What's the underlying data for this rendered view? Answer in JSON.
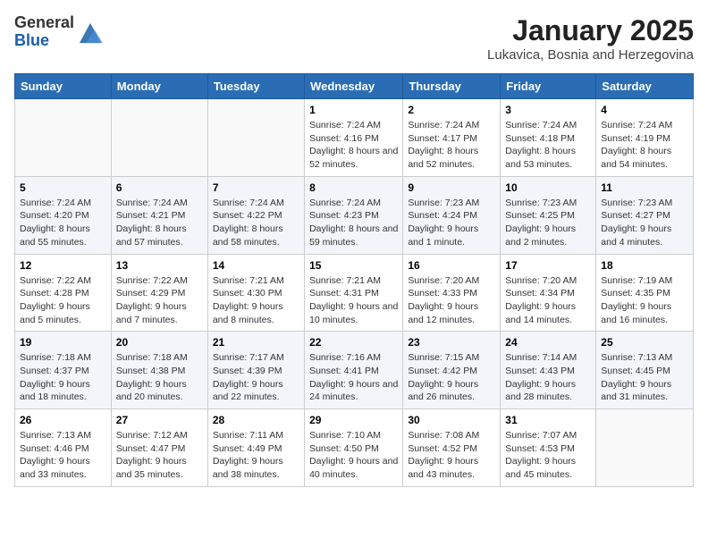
{
  "header": {
    "logo_line1": "General",
    "logo_line2": "Blue",
    "month_title": "January 2025",
    "location": "Lukavica, Bosnia and Herzegovina"
  },
  "weekdays": [
    "Sunday",
    "Monday",
    "Tuesday",
    "Wednesday",
    "Thursday",
    "Friday",
    "Saturday"
  ],
  "weeks": [
    [
      {
        "day": "",
        "info": ""
      },
      {
        "day": "",
        "info": ""
      },
      {
        "day": "",
        "info": ""
      },
      {
        "day": "1",
        "info": "Sunrise: 7:24 AM\nSunset: 4:16 PM\nDaylight: 8 hours and 52 minutes."
      },
      {
        "day": "2",
        "info": "Sunrise: 7:24 AM\nSunset: 4:17 PM\nDaylight: 8 hours and 52 minutes."
      },
      {
        "day": "3",
        "info": "Sunrise: 7:24 AM\nSunset: 4:18 PM\nDaylight: 8 hours and 53 minutes."
      },
      {
        "day": "4",
        "info": "Sunrise: 7:24 AM\nSunset: 4:19 PM\nDaylight: 8 hours and 54 minutes."
      }
    ],
    [
      {
        "day": "5",
        "info": "Sunrise: 7:24 AM\nSunset: 4:20 PM\nDaylight: 8 hours and 55 minutes."
      },
      {
        "day": "6",
        "info": "Sunrise: 7:24 AM\nSunset: 4:21 PM\nDaylight: 8 hours and 57 minutes."
      },
      {
        "day": "7",
        "info": "Sunrise: 7:24 AM\nSunset: 4:22 PM\nDaylight: 8 hours and 58 minutes."
      },
      {
        "day": "8",
        "info": "Sunrise: 7:24 AM\nSunset: 4:23 PM\nDaylight: 8 hours and 59 minutes."
      },
      {
        "day": "9",
        "info": "Sunrise: 7:23 AM\nSunset: 4:24 PM\nDaylight: 9 hours and 1 minute."
      },
      {
        "day": "10",
        "info": "Sunrise: 7:23 AM\nSunset: 4:25 PM\nDaylight: 9 hours and 2 minutes."
      },
      {
        "day": "11",
        "info": "Sunrise: 7:23 AM\nSunset: 4:27 PM\nDaylight: 9 hours and 4 minutes."
      }
    ],
    [
      {
        "day": "12",
        "info": "Sunrise: 7:22 AM\nSunset: 4:28 PM\nDaylight: 9 hours and 5 minutes."
      },
      {
        "day": "13",
        "info": "Sunrise: 7:22 AM\nSunset: 4:29 PM\nDaylight: 9 hours and 7 minutes."
      },
      {
        "day": "14",
        "info": "Sunrise: 7:21 AM\nSunset: 4:30 PM\nDaylight: 9 hours and 8 minutes."
      },
      {
        "day": "15",
        "info": "Sunrise: 7:21 AM\nSunset: 4:31 PM\nDaylight: 9 hours and 10 minutes."
      },
      {
        "day": "16",
        "info": "Sunrise: 7:20 AM\nSunset: 4:33 PM\nDaylight: 9 hours and 12 minutes."
      },
      {
        "day": "17",
        "info": "Sunrise: 7:20 AM\nSunset: 4:34 PM\nDaylight: 9 hours and 14 minutes."
      },
      {
        "day": "18",
        "info": "Sunrise: 7:19 AM\nSunset: 4:35 PM\nDaylight: 9 hours and 16 minutes."
      }
    ],
    [
      {
        "day": "19",
        "info": "Sunrise: 7:18 AM\nSunset: 4:37 PM\nDaylight: 9 hours and 18 minutes."
      },
      {
        "day": "20",
        "info": "Sunrise: 7:18 AM\nSunset: 4:38 PM\nDaylight: 9 hours and 20 minutes."
      },
      {
        "day": "21",
        "info": "Sunrise: 7:17 AM\nSunset: 4:39 PM\nDaylight: 9 hours and 22 minutes."
      },
      {
        "day": "22",
        "info": "Sunrise: 7:16 AM\nSunset: 4:41 PM\nDaylight: 9 hours and 24 minutes."
      },
      {
        "day": "23",
        "info": "Sunrise: 7:15 AM\nSunset: 4:42 PM\nDaylight: 9 hours and 26 minutes."
      },
      {
        "day": "24",
        "info": "Sunrise: 7:14 AM\nSunset: 4:43 PM\nDaylight: 9 hours and 28 minutes."
      },
      {
        "day": "25",
        "info": "Sunrise: 7:13 AM\nSunset: 4:45 PM\nDaylight: 9 hours and 31 minutes."
      }
    ],
    [
      {
        "day": "26",
        "info": "Sunrise: 7:13 AM\nSunset: 4:46 PM\nDaylight: 9 hours and 33 minutes."
      },
      {
        "day": "27",
        "info": "Sunrise: 7:12 AM\nSunset: 4:47 PM\nDaylight: 9 hours and 35 minutes."
      },
      {
        "day": "28",
        "info": "Sunrise: 7:11 AM\nSunset: 4:49 PM\nDaylight: 9 hours and 38 minutes."
      },
      {
        "day": "29",
        "info": "Sunrise: 7:10 AM\nSunset: 4:50 PM\nDaylight: 9 hours and 40 minutes."
      },
      {
        "day": "30",
        "info": "Sunrise: 7:08 AM\nSunset: 4:52 PM\nDaylight: 9 hours and 43 minutes."
      },
      {
        "day": "31",
        "info": "Sunrise: 7:07 AM\nSunset: 4:53 PM\nDaylight: 9 hours and 45 minutes."
      },
      {
        "day": "",
        "info": ""
      }
    ]
  ]
}
